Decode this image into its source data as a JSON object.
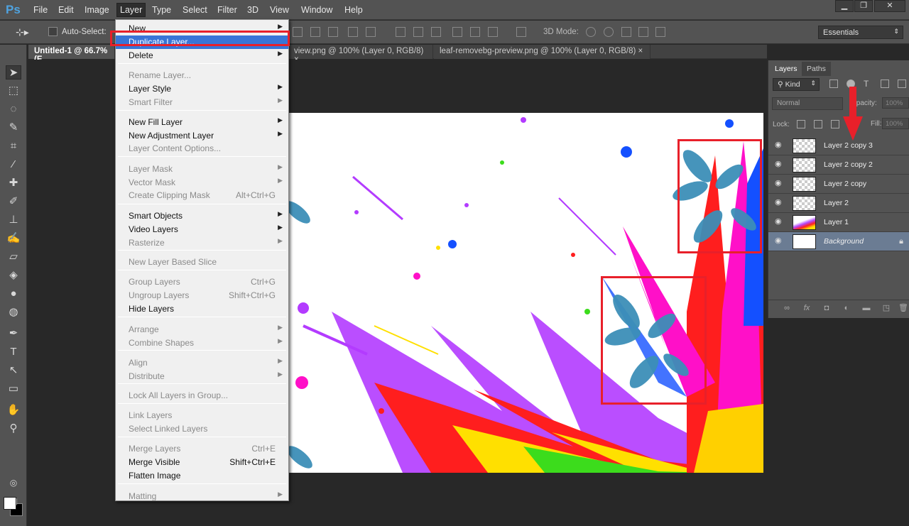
{
  "app": {
    "logo": "Ps"
  },
  "menubar": {
    "items": [
      "File",
      "Edit",
      "Image",
      "Layer",
      "Type",
      "Select",
      "Filter",
      "3D",
      "View",
      "Window",
      "Help"
    ],
    "active": "Layer"
  },
  "window_controls": {
    "minimize": "▁",
    "restore": "❐",
    "close": "✕"
  },
  "options_bar": {
    "auto_select_label": "Auto-Select:",
    "mode_3d_label": "3D Mode:",
    "workspace": "Essentials"
  },
  "tabs": [
    {
      "label": "Untitled-1 @ 66.7% (E",
      "close": ""
    },
    {
      "label": "view.png @ 100% (Layer 0, RGB/8)",
      "close": "×"
    },
    {
      "label": "leaf-removebg-preview.png @ 100% (Layer 0, RGB/8)",
      "close": "×"
    }
  ],
  "layer_menu": {
    "items": [
      {
        "label": "New",
        "submenu": true,
        "disabled": false
      },
      {
        "label": "Duplicate Layer...",
        "disabled": false,
        "highlight": true
      },
      {
        "label": "Delete",
        "submenu": true,
        "disabled": false
      },
      {
        "label": "Rename Layer...",
        "disabled": true
      },
      {
        "label": "Layer Style",
        "submenu": true,
        "disabled": false
      },
      {
        "label": "Smart Filter",
        "submenu": true,
        "disabled": true
      },
      {
        "label": "New Fill Layer",
        "submenu": true,
        "disabled": false
      },
      {
        "label": "New Adjustment Layer",
        "submenu": true,
        "disabled": false
      },
      {
        "label": "Layer Content Options...",
        "disabled": true
      },
      {
        "label": "Layer Mask",
        "submenu": true,
        "disabled": true
      },
      {
        "label": "Vector Mask",
        "submenu": true,
        "disabled": true
      },
      {
        "label": "Create Clipping Mask",
        "shortcut": "Alt+Ctrl+G",
        "disabled": true
      },
      {
        "label": "Smart Objects",
        "submenu": true,
        "disabled": false
      },
      {
        "label": "Video Layers",
        "submenu": true,
        "disabled": false
      },
      {
        "label": "Rasterize",
        "submenu": true,
        "disabled": true
      },
      {
        "label": "New Layer Based Slice",
        "disabled": true
      },
      {
        "label": "Group Layers",
        "shortcut": "Ctrl+G",
        "disabled": true
      },
      {
        "label": "Ungroup Layers",
        "shortcut": "Shift+Ctrl+G",
        "disabled": true
      },
      {
        "label": "Hide Layers",
        "disabled": false
      },
      {
        "label": "Arrange",
        "submenu": true,
        "disabled": true
      },
      {
        "label": "Combine Shapes",
        "submenu": true,
        "disabled": true
      },
      {
        "label": "Align",
        "submenu": true,
        "disabled": true
      },
      {
        "label": "Distribute",
        "submenu": true,
        "disabled": true
      },
      {
        "label": "Lock All Layers in Group...",
        "disabled": true
      },
      {
        "label": "Link Layers",
        "disabled": true
      },
      {
        "label": "Select Linked Layers",
        "disabled": true
      },
      {
        "label": "Merge Layers",
        "shortcut": "Ctrl+E",
        "disabled": true
      },
      {
        "label": "Merge Visible",
        "shortcut": "Shift+Ctrl+E",
        "disabled": false
      },
      {
        "label": "Flatten Image",
        "disabled": false
      },
      {
        "label": "Matting",
        "submenu": true,
        "disabled": true
      }
    ]
  },
  "layers_panel": {
    "tabs": [
      "Layers",
      "Paths"
    ],
    "filter_kind": "Kind",
    "blend_mode": "Normal",
    "opacity_label": "Opacity:",
    "opacity_value": "100%",
    "lock_label": "Lock:",
    "fill_label": "Fill:",
    "fill_value": "100%",
    "layers": [
      {
        "name": "Layer 2 copy 3"
      },
      {
        "name": "Layer 2 copy 2"
      },
      {
        "name": "Layer 2 copy"
      },
      {
        "name": "Layer 2"
      },
      {
        "name": "Layer 1"
      },
      {
        "name": "Background",
        "locked": true,
        "selected": true
      }
    ]
  },
  "colors": {
    "highlight": "#3875d7",
    "annotation_red": "#e8202a",
    "panel_bg": "#535353"
  }
}
